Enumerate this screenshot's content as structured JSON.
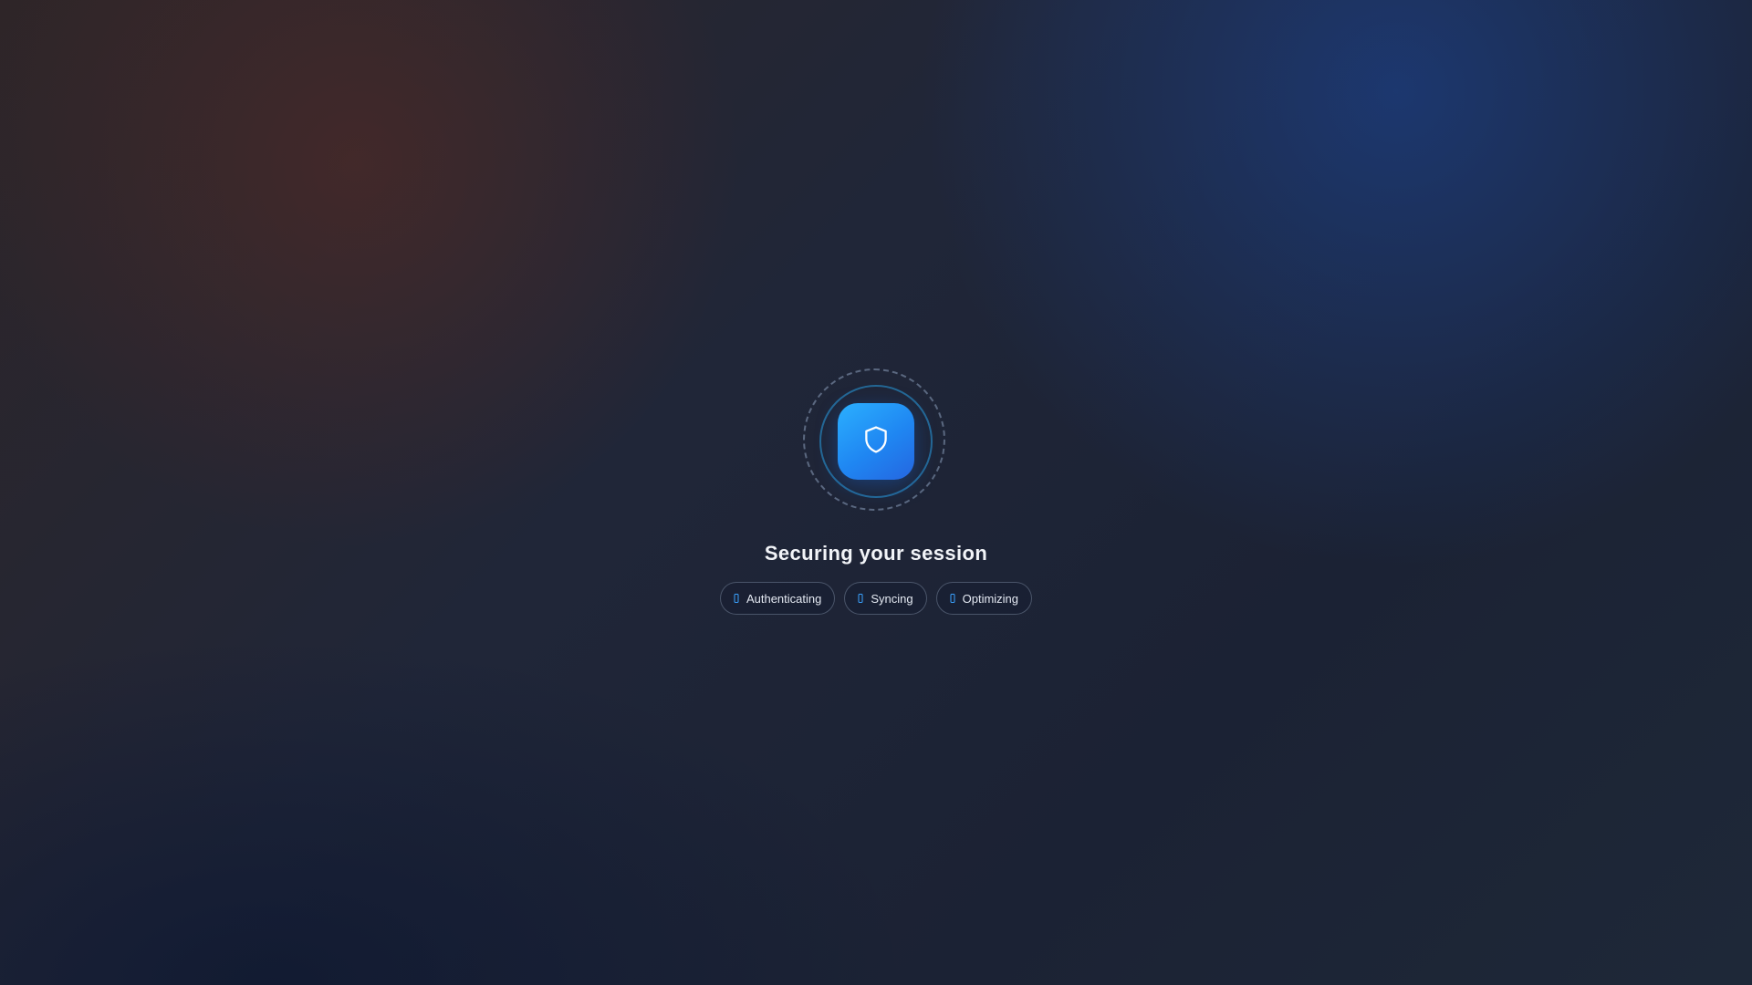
{
  "loading_screen": {
    "title": "Securing your session",
    "center_icon": "shield-icon",
    "steps": [
      {
        "label": "Authenticating",
        "icon": "status-icon"
      },
      {
        "label": "Syncing",
        "icon": "status-icon"
      },
      {
        "label": "Optimizing",
        "icon": "status-icon"
      }
    ]
  },
  "colors": {
    "accent": "#1f86f2",
    "ring": "#288cc8",
    "chip_icon": "#3aa2ff"
  }
}
